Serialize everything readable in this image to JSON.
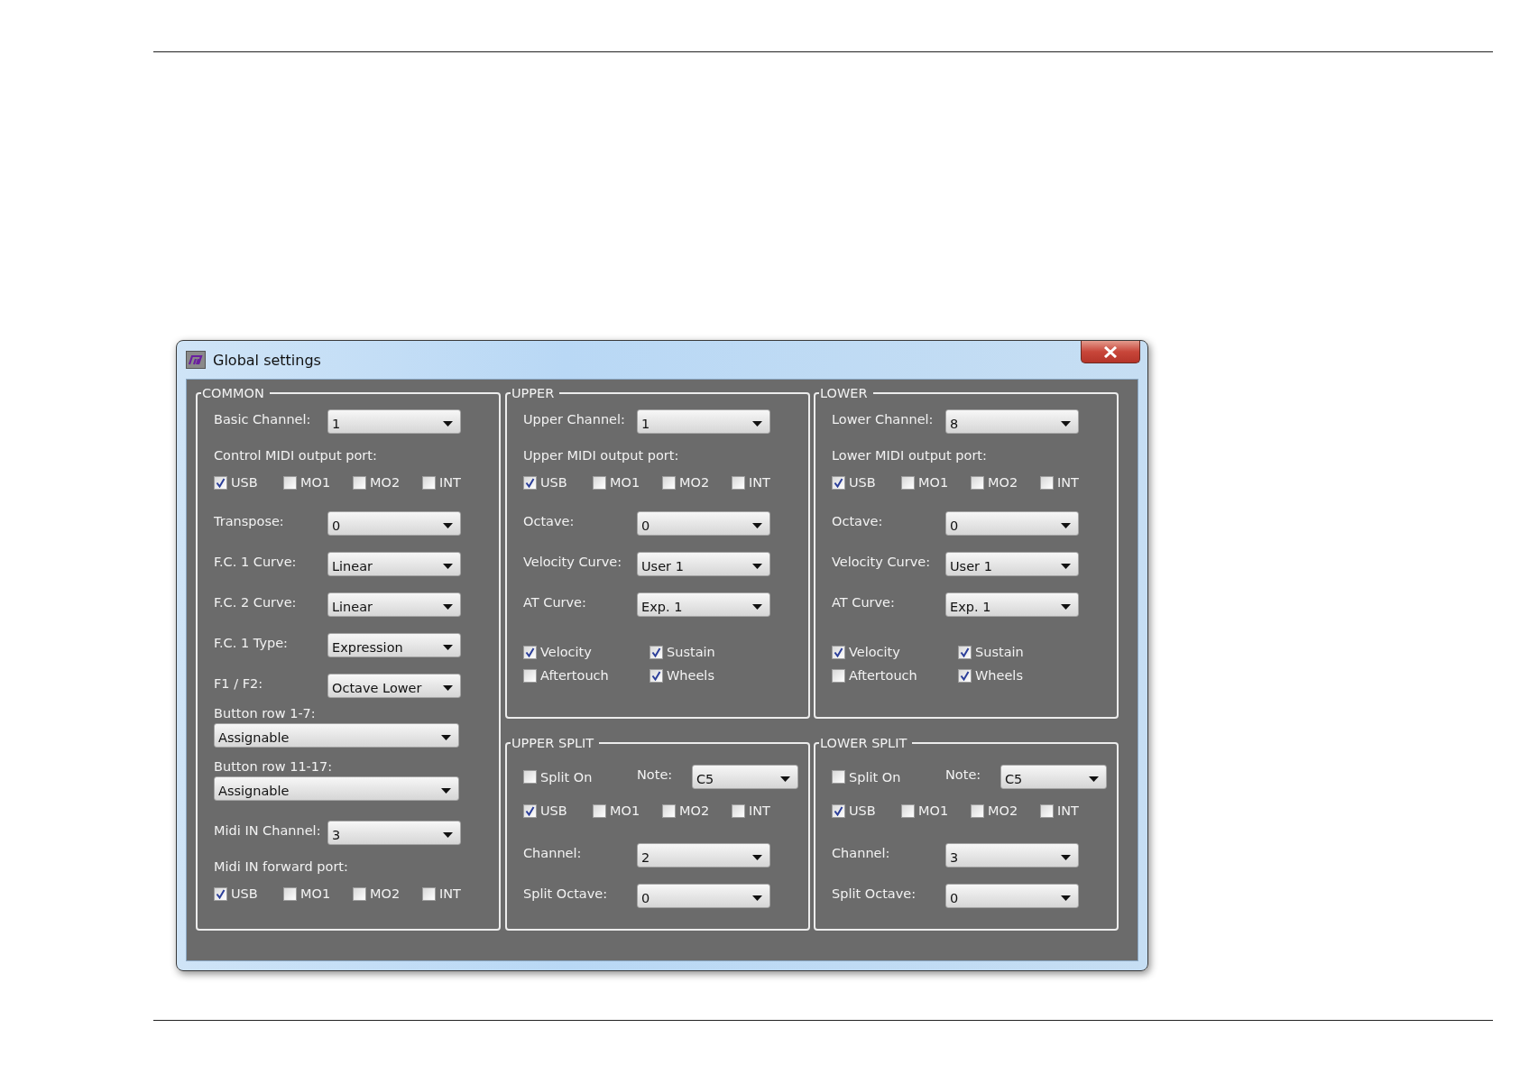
{
  "window": {
    "title": "Global settings"
  },
  "groups": [
    {
      "title": "COMMON",
      "rows": [
        {
          "kind": "select",
          "label": "Basic Channel:",
          "value": "1"
        },
        {
          "kind": "label",
          "text": "Control MIDI output port:"
        },
        {
          "kind": "ports",
          "items": [
            {
              "label": "USB",
              "checked": true
            },
            {
              "label": "MO1",
              "checked": false
            },
            {
              "label": "MO2",
              "checked": false
            },
            {
              "label": "INT",
              "checked": false
            }
          ]
        },
        {
          "kind": "select",
          "label": "Transpose:",
          "value": "0"
        },
        {
          "kind": "select",
          "label": "F.C. 1 Curve:",
          "value": "Linear"
        },
        {
          "kind": "select",
          "label": "F.C. 2 Curve:",
          "value": "Linear"
        },
        {
          "kind": "select",
          "label": "F.C. 1 Type:",
          "value": "Expression"
        },
        {
          "kind": "select",
          "label": "F1 / F2:",
          "value": "Octave Lower"
        },
        {
          "kind": "wide",
          "label": "Button row 1-7:",
          "value": "Assignable"
        },
        {
          "kind": "wide",
          "label": "Button row 11-17:",
          "value": "Assignable"
        },
        {
          "kind": "select",
          "label": "Midi IN Channel:",
          "value": "3"
        },
        {
          "kind": "label",
          "text": "Midi IN forward port:"
        },
        {
          "kind": "ports",
          "items": [
            {
              "label": "USB",
              "checked": true
            },
            {
              "label": "MO1",
              "checked": false
            },
            {
              "label": "MO2",
              "checked": false
            },
            {
              "label": "INT",
              "checked": false
            }
          ]
        }
      ]
    },
    {
      "title": "UPPER",
      "rows": [
        {
          "kind": "select",
          "label": "Upper Channel:",
          "value": "1"
        },
        {
          "kind": "label",
          "text": "Upper MIDI output port:"
        },
        {
          "kind": "ports",
          "items": [
            {
              "label": "USB",
              "checked": true
            },
            {
              "label": "MO1",
              "checked": false
            },
            {
              "label": "MO2",
              "checked": false
            },
            {
              "label": "INT",
              "checked": false
            }
          ]
        },
        {
          "kind": "select",
          "label": "Octave:",
          "value": "0"
        },
        {
          "kind": "select",
          "label": "Velocity Curve:",
          "value": "User 1"
        },
        {
          "kind": "select",
          "label": "AT Curve:",
          "value": "Exp. 1"
        },
        {
          "kind": "checks",
          "items": [
            {
              "label": "Velocity",
              "checked": true
            },
            {
              "label": "Sustain",
              "checked": true
            },
            {
              "label": "Aftertouch",
              "checked": false
            },
            {
              "label": "Wheels",
              "checked": true
            }
          ]
        }
      ]
    },
    {
      "title": "UPPER SPLIT",
      "rows": [
        {
          "kind": "split",
          "check": {
            "label": "Split On",
            "checked": false
          },
          "label": "Note:",
          "value": "C5"
        },
        {
          "kind": "ports",
          "items": [
            {
              "label": "USB",
              "checked": true
            },
            {
              "label": "MO1",
              "checked": false
            },
            {
              "label": "MO2",
              "checked": false
            },
            {
              "label": "INT",
              "checked": false
            }
          ]
        },
        {
          "kind": "select",
          "label": "Channel:",
          "value": "2"
        },
        {
          "kind": "select",
          "label": "Split Octave:",
          "value": "0"
        }
      ]
    },
    {
      "title": "LOWER",
      "rows": [
        {
          "kind": "select",
          "label": "Lower Channel:",
          "value": "8"
        },
        {
          "kind": "label",
          "text": "Lower MIDI output port:"
        },
        {
          "kind": "ports",
          "items": [
            {
              "label": "USB",
              "checked": true
            },
            {
              "label": "MO1",
              "checked": false
            },
            {
              "label": "MO2",
              "checked": false
            },
            {
              "label": "INT",
              "checked": false
            }
          ]
        },
        {
          "kind": "select",
          "label": "Octave:",
          "value": "0"
        },
        {
          "kind": "select",
          "label": "Velocity Curve:",
          "value": "User 1"
        },
        {
          "kind": "select",
          "label": "AT Curve:",
          "value": "Exp. 1"
        },
        {
          "kind": "checks",
          "items": [
            {
              "label": "Velocity",
              "checked": true
            },
            {
              "label": "Sustain",
              "checked": true
            },
            {
              "label": "Aftertouch",
              "checked": false
            },
            {
              "label": "Wheels",
              "checked": true
            }
          ]
        }
      ]
    },
    {
      "title": "LOWER SPLIT",
      "rows": [
        {
          "kind": "split",
          "check": {
            "label": "Split On",
            "checked": false
          },
          "label": "Note:",
          "value": "C5"
        },
        {
          "kind": "ports",
          "items": [
            {
              "label": "USB",
              "checked": true
            },
            {
              "label": "MO1",
              "checked": false
            },
            {
              "label": "MO2",
              "checked": false
            },
            {
              "label": "INT",
              "checked": false
            }
          ]
        },
        {
          "kind": "select",
          "label": "Channel:",
          "value": "3"
        },
        {
          "kind": "select",
          "label": "Split Octave:",
          "value": "0"
        }
      ]
    }
  ]
}
